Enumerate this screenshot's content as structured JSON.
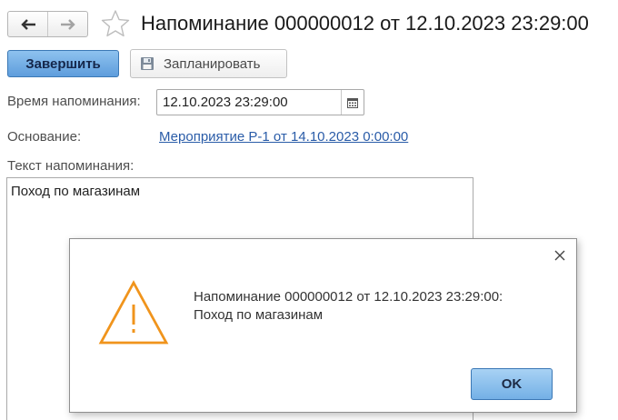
{
  "window": {
    "title": "Напоминание 000000012 от 12.10.2023 23:29:00"
  },
  "nav": {
    "back_icon": "arrow-left-icon",
    "forward_icon": "arrow-right-icon",
    "favorite_icon": "star-outline-icon"
  },
  "toolbar": {
    "finish_label": "Завершить",
    "schedule_label": "Запланировать",
    "schedule_icon": "floppy-disk-icon"
  },
  "form": {
    "time_label": "Время напоминания:",
    "time_value": "12.10.2023 23:29:00",
    "calendar_icon": "calendar-icon",
    "reason_label": "Основание:",
    "reason_link": "Мероприятие Р-1 от 14.10.2023 0:00:00",
    "text_label": "Текст напоминания:",
    "text_value": "Поход по магазинам"
  },
  "dialog": {
    "line1": "Напоминание 000000012 от 12.10.2023 23:29:00:",
    "line2": "Поход по магазинам",
    "ok_label": "OK",
    "icon": "warning-triangle-icon",
    "close_icon": "close-icon"
  },
  "colors": {
    "accent_button": "#5e9ddc",
    "link": "#2a5ca8",
    "warning": "#f0941c"
  }
}
